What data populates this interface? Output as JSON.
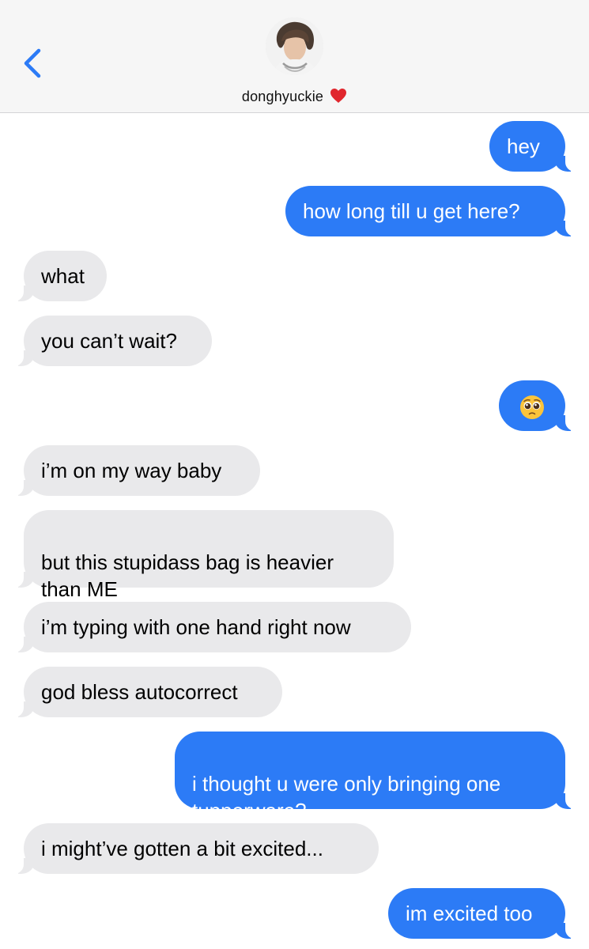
{
  "header": {
    "contact_name": "donghyuckie",
    "back_icon": "chevron-left-icon",
    "heart_icon": "red-heart-icon",
    "avatar_icon": "contact-avatar"
  },
  "colors": {
    "sent_bubble": "#2c7bf6",
    "received_bubble": "#e9e9eb",
    "accent": "#2c7bf6"
  },
  "messages": [
    {
      "from": "me",
      "text": "hey"
    },
    {
      "from": "me",
      "text": "how long till u get here?"
    },
    {
      "from": "them",
      "text": "what"
    },
    {
      "from": "them",
      "text": "you can’t wait?"
    },
    {
      "from": "me",
      "text": "🥺",
      "icon": "pleading-face-emoji"
    },
    {
      "from": "them",
      "text": "i’m on my way baby"
    },
    {
      "from": "them",
      "text": "but this stupidass bag is heavier\nthan ME"
    },
    {
      "from": "them",
      "text": "i’m typing with one hand right now"
    },
    {
      "from": "them",
      "text": "god bless autocorrect"
    },
    {
      "from": "me",
      "text": "i thought u were only bringing one\ntupperware?"
    },
    {
      "from": "them",
      "text": "i might’ve gotten a bit excited..."
    },
    {
      "from": "me",
      "text": "im excited too"
    }
  ]
}
